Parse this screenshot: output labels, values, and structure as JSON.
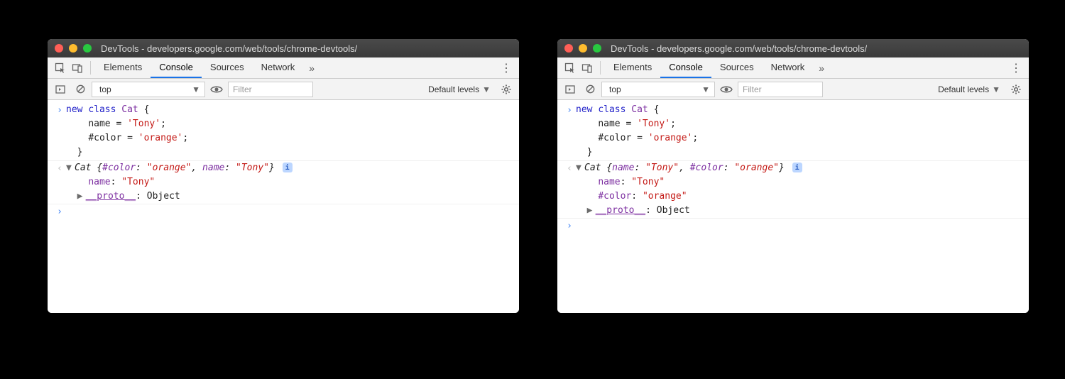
{
  "windows": [
    {
      "title": "DevTools - developers.google.com/web/tools/chrome-devtools/",
      "tabs": [
        "Elements",
        "Console",
        "Sources",
        "Network"
      ],
      "active_tab": "Console",
      "toolbar": {
        "context": "top",
        "filter_placeholder": "Filter",
        "levels_label": "Default levels"
      },
      "input_code": {
        "l1": {
          "kw1": "new",
          "kw2": "class",
          "cls": "Cat",
          "brace": " {"
        },
        "l2": {
          "indent": "    ",
          "name": "name",
          "eq": " = ",
          "val": "'Tony'",
          "semi": ";"
        },
        "l3": {
          "indent": "    ",
          "name": "#color",
          "eq": " = ",
          "val": "'orange'",
          "semi": ";"
        },
        "l4": "  }"
      },
      "output": {
        "summary": {
          "cls": "Cat",
          "open": " {",
          "k1": "#color",
          "sep1": ": ",
          "v1": "\"orange\"",
          "comma": ", ",
          "k2": "name",
          "sep2": ": ",
          "v2": "\"Tony\"",
          "close": "}"
        },
        "props": [
          {
            "key": "name",
            "sep": ": ",
            "val": "\"Tony\""
          }
        ],
        "proto": {
          "key": "__proto__",
          "sep": ": ",
          "val": "Object"
        }
      }
    },
    {
      "title": "DevTools - developers.google.com/web/tools/chrome-devtools/",
      "tabs": [
        "Elements",
        "Console",
        "Sources",
        "Network"
      ],
      "active_tab": "Console",
      "toolbar": {
        "context": "top",
        "filter_placeholder": "Filter",
        "levels_label": "Default levels"
      },
      "input_code": {
        "l1": {
          "kw1": "new",
          "kw2": "class",
          "cls": "Cat",
          "brace": " {"
        },
        "l2": {
          "indent": "    ",
          "name": "name",
          "eq": " = ",
          "val": "'Tony'",
          "semi": ";"
        },
        "l3": {
          "indent": "    ",
          "name": "#color",
          "eq": " = ",
          "val": "'orange'",
          "semi": ";"
        },
        "l4": "  }"
      },
      "output": {
        "summary": {
          "cls": "Cat",
          "open": " {",
          "k1": "name",
          "sep1": ": ",
          "v1": "\"Tony\"",
          "comma": ", ",
          "k2": "#color",
          "sep2": ": ",
          "v2": "\"orange\"",
          "close": "}"
        },
        "props": [
          {
            "key": "name",
            "sep": ": ",
            "val": "\"Tony\""
          },
          {
            "key": "#color",
            "sep": ": ",
            "val": "\"orange\""
          }
        ],
        "proto": {
          "key": "__proto__",
          "sep": ": ",
          "val": "Object"
        }
      }
    }
  ]
}
